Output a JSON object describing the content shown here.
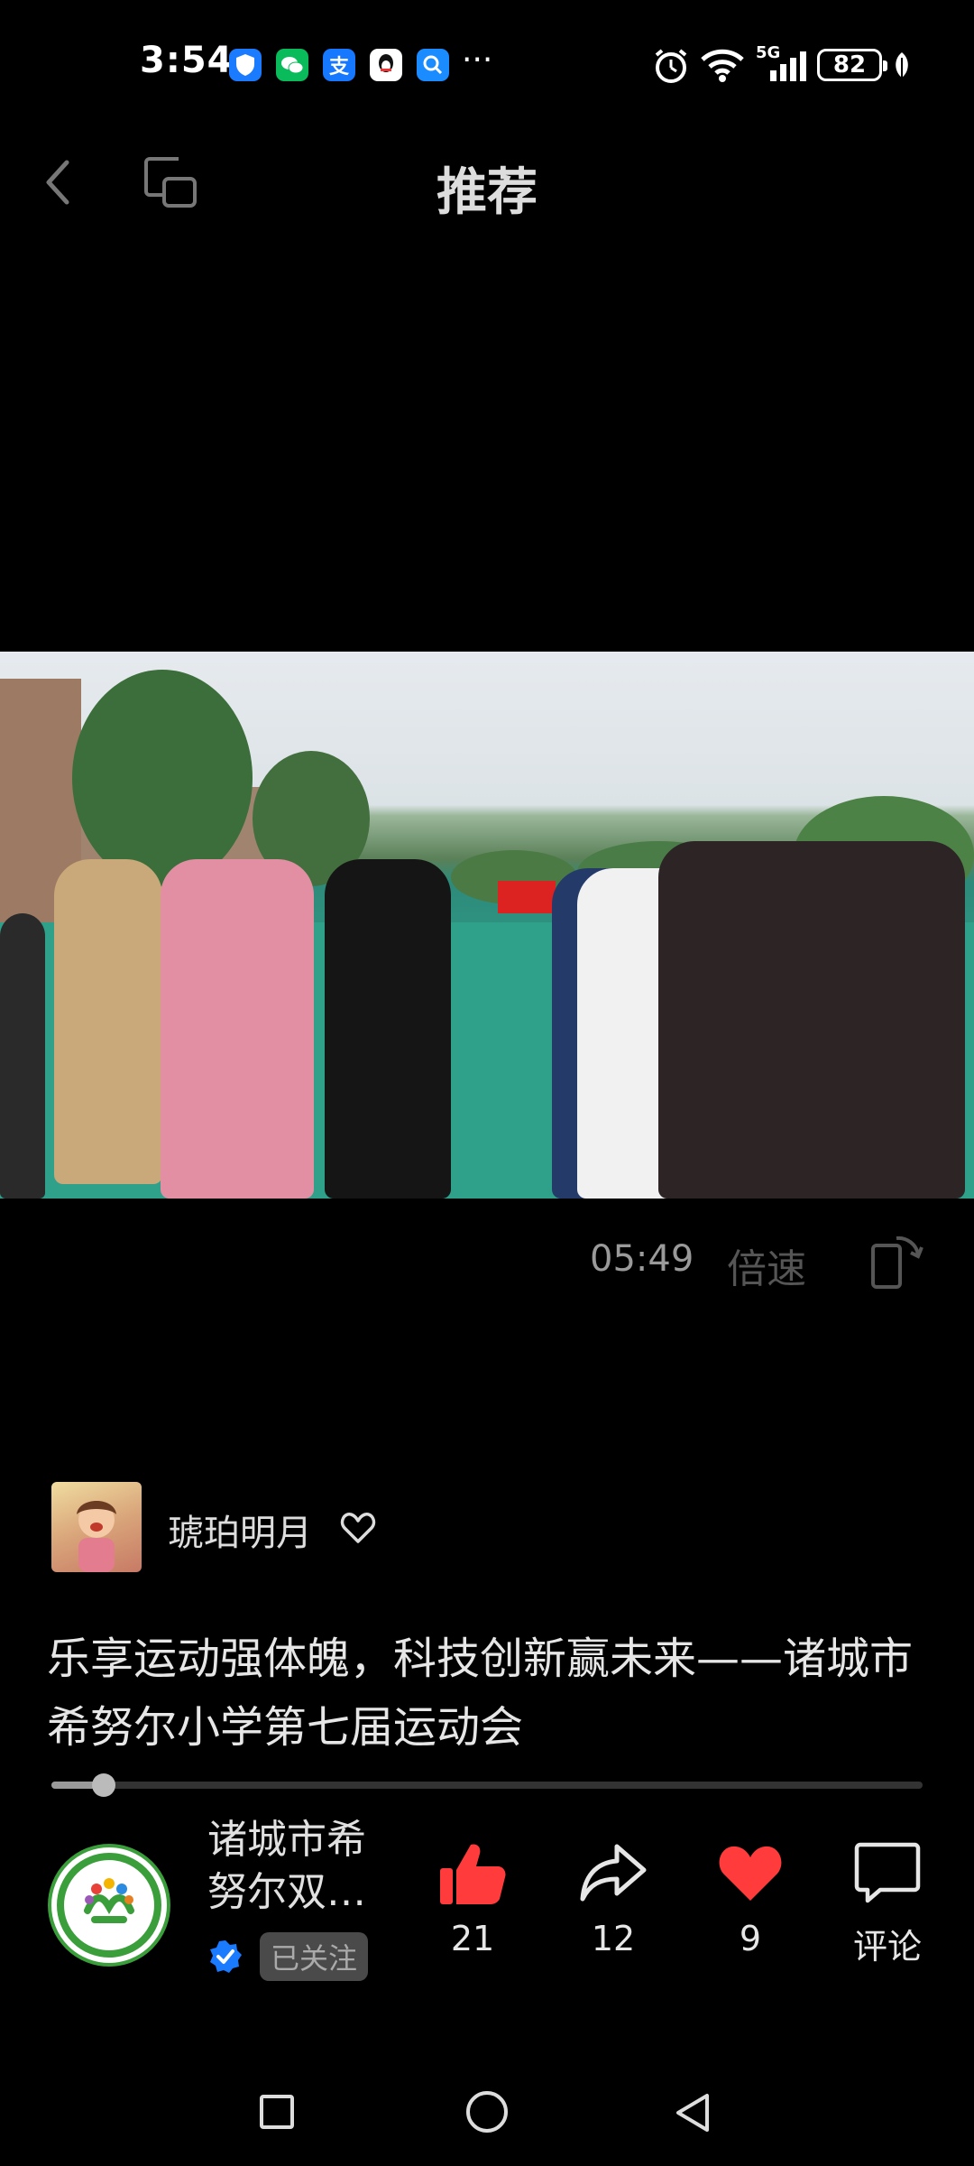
{
  "status_bar": {
    "time": "3:54",
    "notification_icons": [
      "shield-icon",
      "wechat-icon",
      "alipay-icon",
      "qq-icon",
      "search-app-icon"
    ],
    "more": "···",
    "network": "5G",
    "battery": "82"
  },
  "header": {
    "title": "推荐"
  },
  "video": {
    "duration": "05:49",
    "speed_label": "倍速"
  },
  "author": {
    "name": "琥珀明月"
  },
  "caption": "乐享运动强体魄，科技创新赢未来——诸城市希努尔小学第七届运动会",
  "progress": {
    "fraction": 0.06
  },
  "channel": {
    "name": "诸城市希努尔双…",
    "followed_label": "已关注"
  },
  "actions": {
    "like_count": "21",
    "share_count": "12",
    "favorite_count": "9",
    "comment_label": "评论"
  },
  "colors": {
    "like": "#ff3b3b",
    "verified": "#1a7bff"
  }
}
